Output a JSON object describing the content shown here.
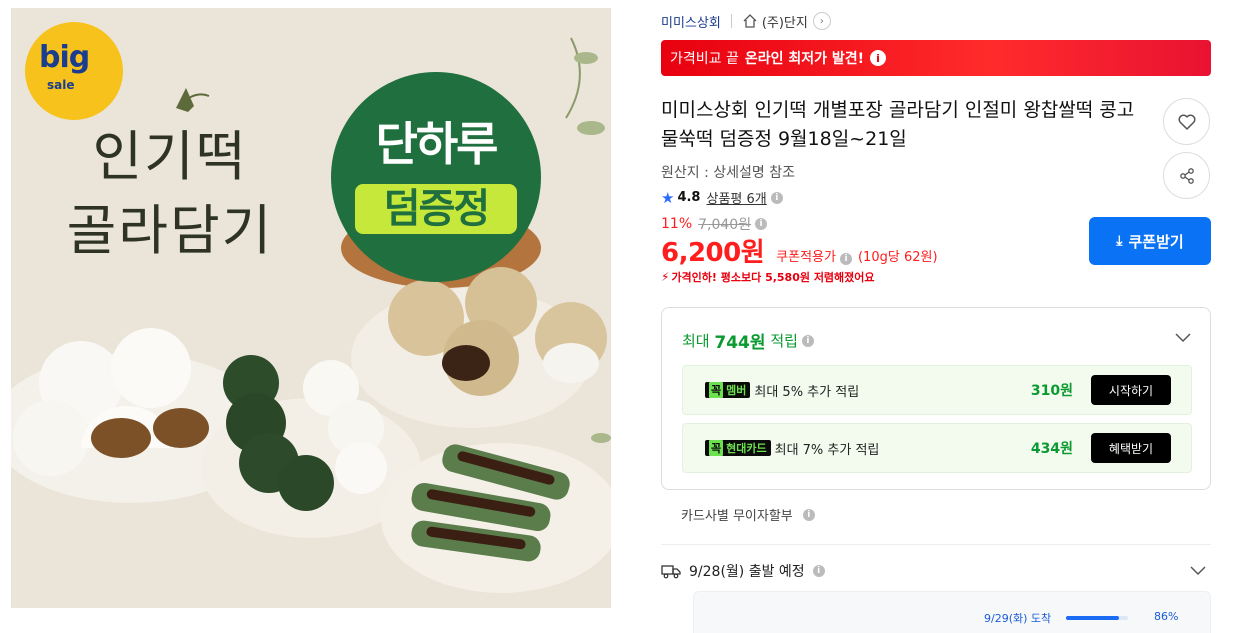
{
  "hero": {
    "badge_big": "big",
    "badge_sale": "sale",
    "title_line1": "인기떡",
    "title_line2": "골라담기",
    "promo_line1": "단하루",
    "promo_line2": "덤증정",
    "colors": {
      "promo_green": "#1f6f3f",
      "promo_lime": "#c6e83a",
      "badge_yellow": "#f7c21b"
    }
  },
  "breadcrumb": {
    "shop": "미미스상회",
    "brand": "(주)단지",
    "home_icon": "home-icon",
    "arrow_icon": "chevron-right-icon"
  },
  "banner": {
    "prefix": "가격비교 끝",
    "strong": "온라인 최저가 발견!",
    "info_icon": "info-icon",
    "color": "#e8000f"
  },
  "product": {
    "title": "미미스상회 인기떡 개별포장 골라담기 인절미 왕찹쌀떡 콩고물쑥떡 덤증정 9월18일~21일",
    "origin": "원산지 : 상세설명 참조",
    "rating": "4.8",
    "reviews": "상품평 6개",
    "discount_rate": "11%",
    "original_price": "7,040원",
    "price": "6,200원",
    "coupon_note": "쿠폰적용가",
    "unit_price": "(10g당 62원)",
    "lowest_note": "가격인하! 평소보다 5,580원 저렴해졌어요",
    "coupon_button": "쿠폰받기",
    "wish_icon": "heart-icon",
    "share_icon": "share-icon"
  },
  "points": {
    "head_prefix": "최대",
    "head_amount": "744원",
    "head_suffix": "적립",
    "rows": [
      {
        "tag_k": "꼭",
        "tag": "멤버",
        "text": "최대 5% 추가 적립",
        "amount": "310원",
        "button": "시작하기"
      },
      {
        "tag_k": "꼭",
        "tag": "현대카드",
        "text": "최대 7% 추가 적립",
        "amount": "434원",
        "button": "혜택받기"
      }
    ]
  },
  "installment": "카드사별 무이자할부",
  "delivery": {
    "text": "9/28(월) 출발 예정",
    "arrival": "9/29(화) 도착",
    "arrival_pct": "86%",
    "arrival_fraction": 0.86
  }
}
